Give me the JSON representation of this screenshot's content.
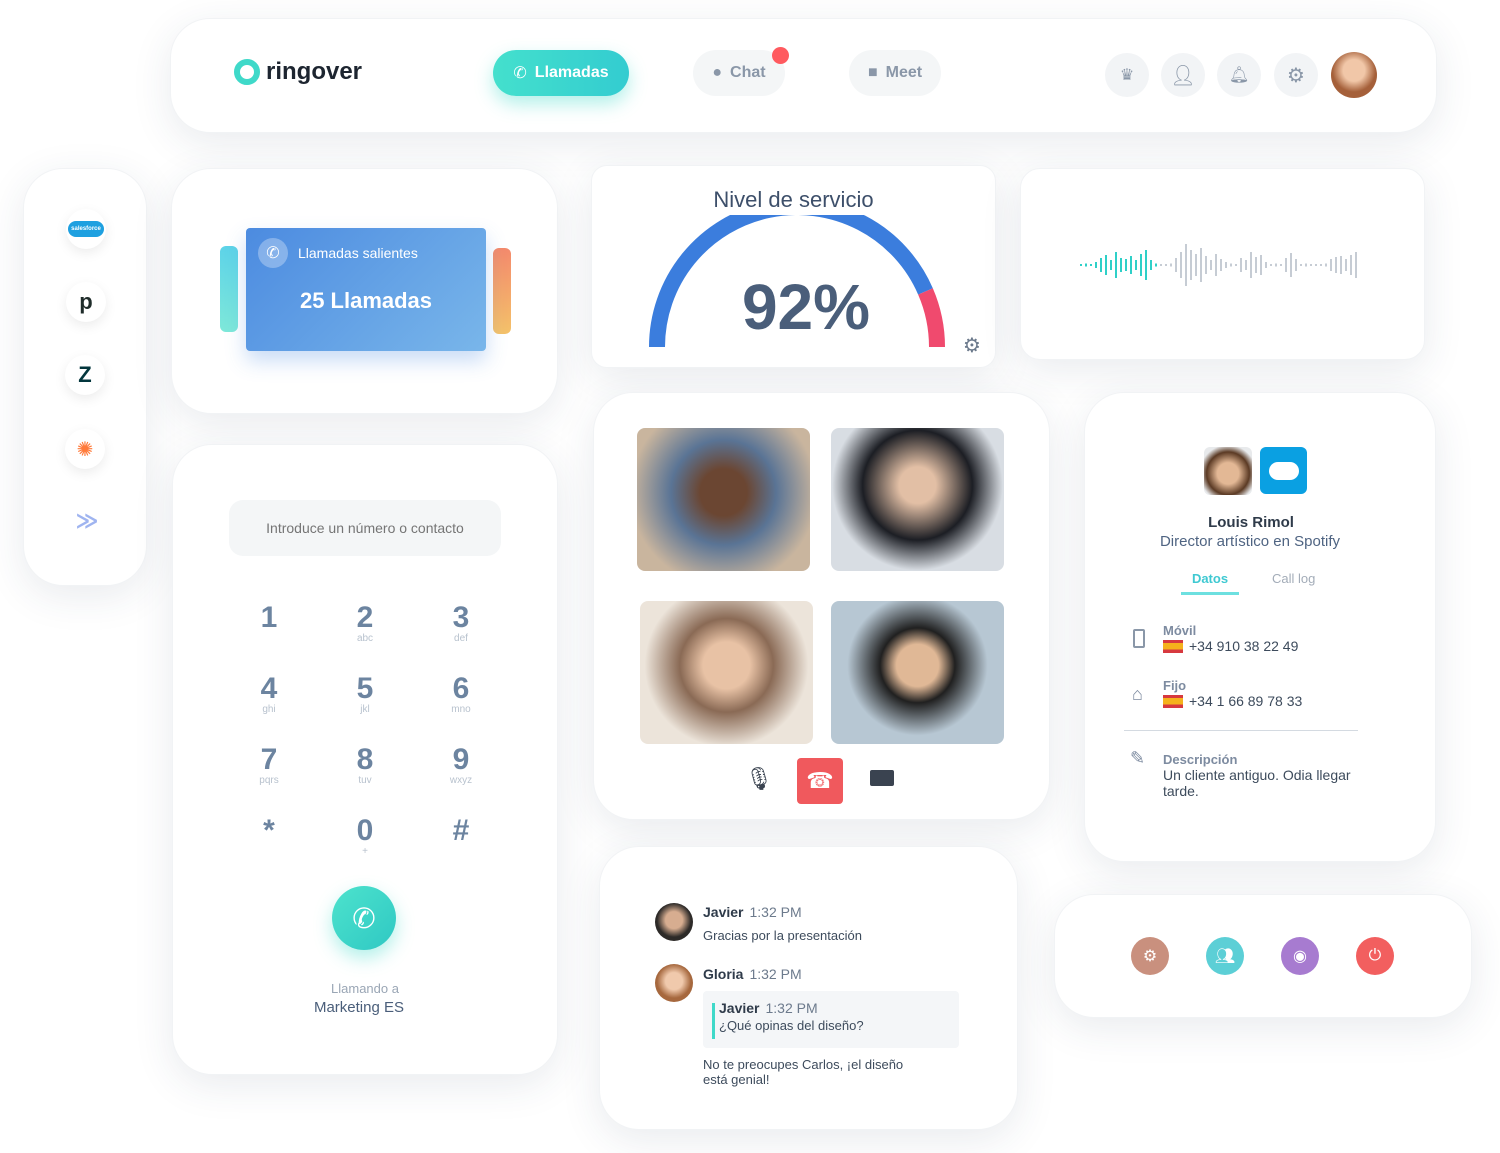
{
  "header": {
    "logo": "ringover",
    "nav": [
      {
        "label": "Llamadas",
        "icon": "phone-icon",
        "active": true
      },
      {
        "label": "Chat",
        "icon": "chat-icon",
        "badge": true
      },
      {
        "label": "Meet",
        "icon": "video-icon"
      }
    ],
    "icons": [
      "crown-icon",
      "user-icon",
      "bell-icon",
      "gear-icon"
    ],
    "accent": "#3fd9c9",
    "badge_color": "#ff5a5f"
  },
  "sidebar": {
    "integrations": [
      {
        "name": "salesforce",
        "label": "salesforce"
      },
      {
        "name": "pipedrive",
        "label": "p"
      },
      {
        "name": "zendesk"
      },
      {
        "name": "hubspot"
      },
      {
        "name": "more"
      }
    ]
  },
  "calls": {
    "label": "Llamadas salientes",
    "value": "25 Llamadas"
  },
  "gauge": {
    "title": "Nivel de servicio",
    "value_label": "92%",
    "value": 92,
    "colors": {
      "main": "#3b7ddd",
      "alert": "#f04a6e"
    }
  },
  "dialer": {
    "placeholder": "Introduce un número o contacto",
    "keys": [
      {
        "d": "1",
        "l": ""
      },
      {
        "d": "2",
        "l": "abc"
      },
      {
        "d": "3",
        "l": "def"
      },
      {
        "d": "4",
        "l": "ghi"
      },
      {
        "d": "5",
        "l": "jkl"
      },
      {
        "d": "6",
        "l": "mno"
      },
      {
        "d": "7",
        "l": "pqrs"
      },
      {
        "d": "8",
        "l": "tuv"
      },
      {
        "d": "9",
        "l": "wxyz"
      },
      {
        "d": "*",
        "l": ""
      },
      {
        "d": "0",
        "l": "+"
      },
      {
        "d": "#",
        "l": ""
      }
    ],
    "calling_label": "Llamando a",
    "calling_target": "Marketing ES"
  },
  "contact": {
    "name": "Louis Rimol",
    "role": "Director artístico en Spotify",
    "tabs": [
      "Datos",
      "Call log"
    ],
    "mobile_label": "Móvil",
    "mobile": "+34 910 38 22 49",
    "landline_label": "Fijo",
    "landline": "+34 1 66 89 78 33",
    "desc_label": "Descripción",
    "desc": "Un cliente antiguo. Odia llegar tarde."
  },
  "chat": {
    "messages": [
      {
        "name": "Javier",
        "time": "1:32 PM",
        "text": "Gracias por la presentación"
      },
      {
        "name": "Gloria",
        "time": "1:32 PM",
        "quote": {
          "name": "Javier",
          "time": "1:32 PM",
          "text": "¿Qué opinas del diseño?"
        },
        "text": "No te preocupes Carlos, ¡el diseño está genial!"
      }
    ]
  },
  "actions": [
    {
      "icon": "gear-icon",
      "color": "#c9907e"
    },
    {
      "icon": "team-icon",
      "color": "#5ccfd6"
    },
    {
      "icon": "contact-icon",
      "color": "#a77bd0"
    },
    {
      "icon": "power-icon",
      "color": "#f25f5f"
    }
  ]
}
